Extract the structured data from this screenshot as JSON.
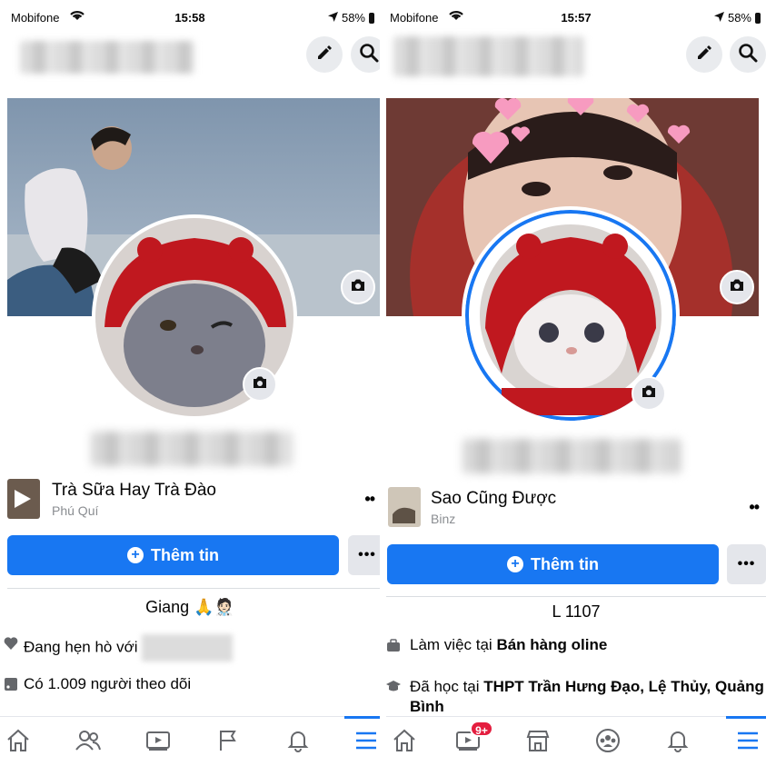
{
  "left_screen": {
    "status": {
      "carrier": "Mobifone",
      "time": "15:58",
      "battery": "58%"
    },
    "song": {
      "title": "Trà Sữa Hay Trà Đào",
      "artist": "Phú Quí"
    },
    "add_story_label": "Thêm tin",
    "more_label": "•••",
    "bio": "Giang 🙏🧑🏻‍⚕️",
    "details": [
      {
        "text": "Đang hẹn hò với",
        "icon": "heart-icon"
      },
      {
        "text": "Có 1.009 người theo dõi",
        "icon": "rss-icon"
      }
    ],
    "tabs": [
      "home-icon",
      "friends-icon",
      "watch-icon",
      "pages-icon",
      "bell-icon",
      "menu-icon"
    ]
  },
  "right_screen": {
    "status": {
      "carrier": "Mobifone",
      "time": "15:57",
      "battery": "58%"
    },
    "song": {
      "title": "Sao Cũng Được",
      "artist": "Binz"
    },
    "add_story_label": "Thêm tin",
    "more_label": "•••",
    "bio": "L 1107",
    "work": {
      "prefix": "Làm việc tại",
      "place": "Bán hàng oline"
    },
    "study": {
      "prefix": "Đã học tại",
      "place": "THPT  Trần Hưng Đạo, Lệ Thủy, Quảng Bình"
    },
    "watch_badge": "9+",
    "tabs": [
      "home-icon",
      "watch-icon",
      "marketplace-icon",
      "groups-icon",
      "bell-icon",
      "menu-icon"
    ]
  },
  "colors": {
    "accent": "#1877f2",
    "badge": "#e41e3f",
    "muted": "#8a8d91"
  }
}
